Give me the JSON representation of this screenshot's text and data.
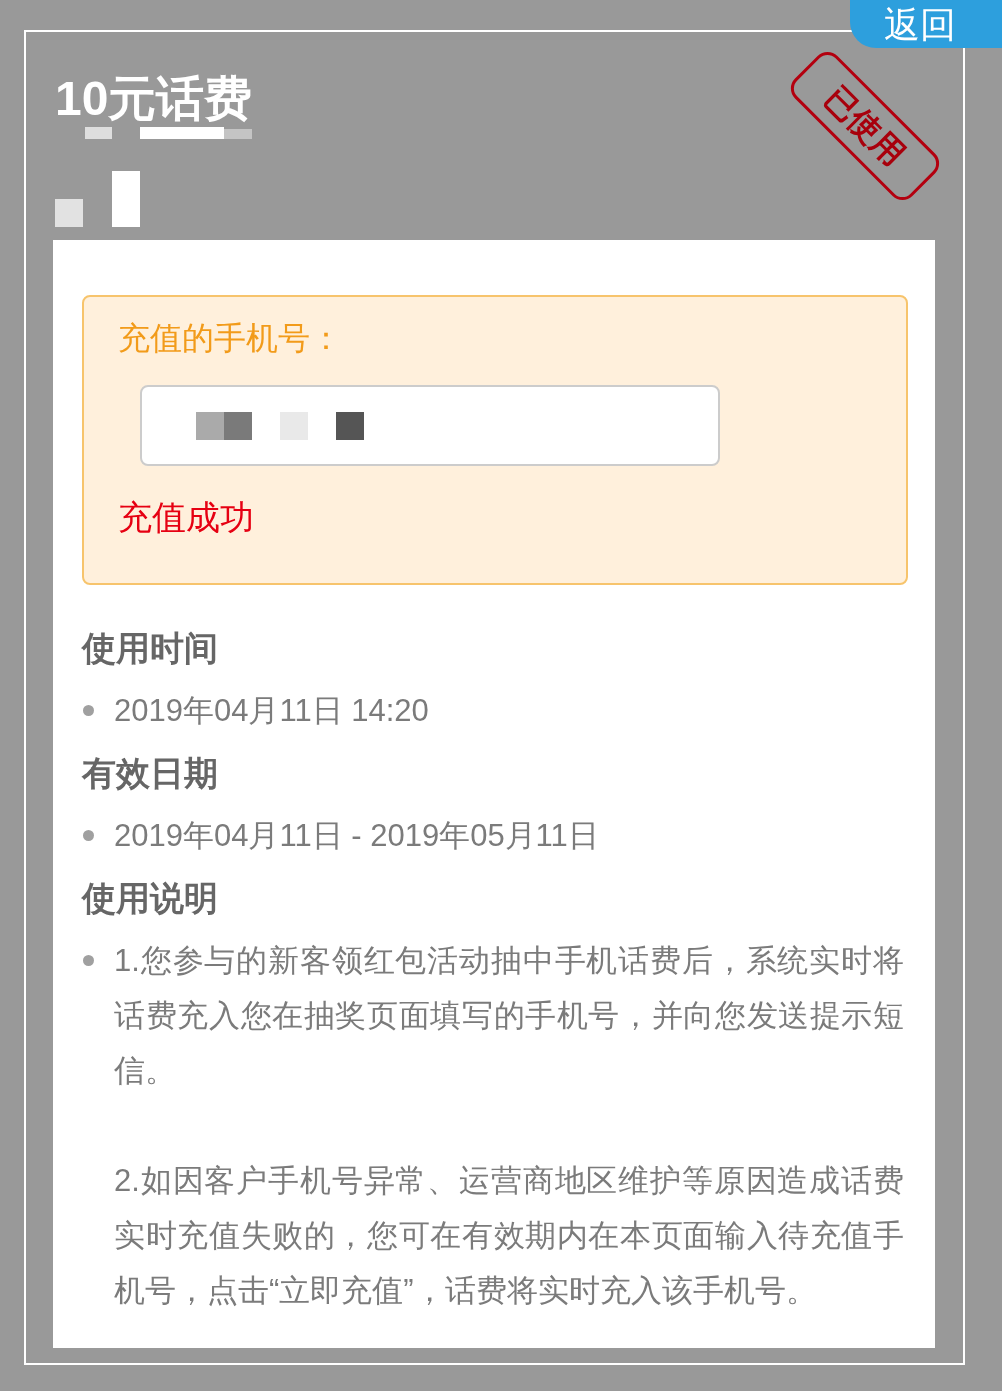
{
  "back_button": {
    "label": "返回"
  },
  "coupon": {
    "title": "10元话费",
    "subtitle_redacted": true,
    "stamp": "已使用"
  },
  "recharge": {
    "label": "充值的手机号：",
    "phone_redacted": true,
    "status": "充值成功"
  },
  "sections": [
    {
      "heading": "使用时间",
      "items": [
        {
          "paragraphs": [
            "2019年04月11日 14:20"
          ]
        }
      ]
    },
    {
      "heading": "有效日期",
      "items": [
        {
          "paragraphs": [
            "2019年04月11日 - 2019年05月11日"
          ]
        }
      ]
    },
    {
      "heading": "使用说明",
      "items": [
        {
          "paragraphs": [
            "1.您参与的新客领红包活动抽中手机话费后，系统实时将话费充入您在抽奖页面填写的手机号，并向您发送提示短信。",
            "2.如因客户手机号异常、运营商地区维护等原因造成话费实时充值失败的，您可在有效期内在本页面输入待充值手机号，点击“立即充值”，话费将实时充入该手机号。"
          ]
        }
      ]
    }
  ]
}
